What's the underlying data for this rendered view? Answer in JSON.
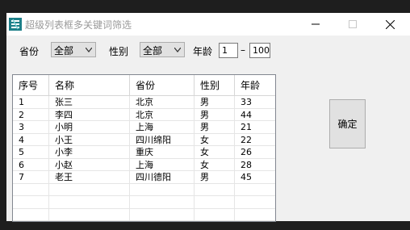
{
  "window": {
    "title": "超级列表框多关键词筛选",
    "controls": [
      "minimize-icon",
      "maximize-icon",
      "close-icon"
    ]
  },
  "filters": {
    "province_label": "省份",
    "province_value": "全部",
    "gender_label": "性别",
    "gender_value": "全部",
    "age_label": "年龄",
    "age_min": "1",
    "age_sep": "–",
    "age_max": "100"
  },
  "table": {
    "columns": [
      "序号",
      "名称",
      "省份",
      "性别",
      "年龄"
    ],
    "rows": [
      [
        "1",
        "张三",
        "北京",
        "男",
        "33"
      ],
      [
        "2",
        "李四",
        "北京",
        "男",
        "44"
      ],
      [
        "3",
        "小明",
        "上海",
        "男",
        "21"
      ],
      [
        "4",
        "小王",
        "四川绵阳",
        "女",
        "22"
      ],
      [
        "5",
        "小李",
        "重庆",
        "女",
        "26"
      ],
      [
        "6",
        "小赵",
        "上海",
        "女",
        "28"
      ],
      [
        "7",
        "老王",
        "四川德阳",
        "男",
        "45"
      ]
    ]
  },
  "ok_button": "确定"
}
